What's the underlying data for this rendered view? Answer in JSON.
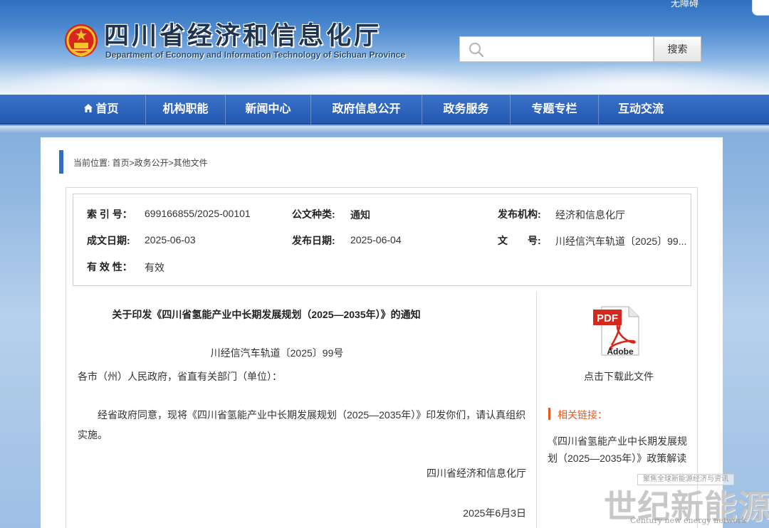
{
  "header": {
    "accessibility_label": "无障碍",
    "site_title": "四川省经济和信息化厅",
    "site_subtitle": "Department of Economy and Information Technology of Sichuan Province",
    "search": {
      "placeholder": "",
      "value": "",
      "button_label": "搜索"
    }
  },
  "nav": {
    "items": [
      {
        "label": "首页",
        "icon": "home-icon"
      },
      {
        "label": "机构职能"
      },
      {
        "label": "新闻中心"
      },
      {
        "label": "政府信息公开"
      },
      {
        "label": "政务服务"
      },
      {
        "label": "专题专栏"
      },
      {
        "label": "互动交流"
      }
    ]
  },
  "breadcrumb": "当前位置: 首页>政务公开>其他文件",
  "info": {
    "index_label": "索 引 号：",
    "index_value": "699166855/2025-00101",
    "category_label": "公文种类:",
    "category_value": "通知",
    "issuer_label": "发布机构:",
    "issuer_value": "经济和信息化厅",
    "created_label": "成文日期:",
    "created_value": "2025-06-03",
    "published_label": "发布日期:",
    "published_value": "2025-06-04",
    "docno_label": "文　　号:",
    "docno_value": "川经信汽车轨道〔2025〕99...",
    "validity_label": "有 效 性：",
    "validity_value": "有效"
  },
  "document": {
    "title": "关于印发《四川省氢能产业中长期发展规划（2025—2035年）》的通知",
    "number": "川经信汽车轨道〔2025〕99号",
    "addressee": "各市（州）人民政府，省直有关部门（单位）：",
    "body": "经省政府同意，现将《四川省氢能产业中长期发展规划（2025—2035年）》印发你们，请认真组织实施。",
    "signature": "四川省经济和信息化厅",
    "date": "2025年6月3日"
  },
  "sidebar": {
    "pdf_icon": "pdf-icon",
    "pdf_badge": "PDF",
    "pdf_brand": "Adobe",
    "download_label": "点击下载此文件",
    "related_heading": "相关链接：",
    "related_link": "《四川省氢能产业中长期发展规划（2025—2035年）》政策解读"
  },
  "watermark": {
    "tag": "聚焦全球新能源经济与资讯",
    "main": "世纪新能源网",
    "sub": "Century new energy network"
  },
  "colors": {
    "nav_blue": "#2558b0",
    "accent_orange": "#e8581c",
    "crumb_blue": "#2f6ec4",
    "pdf_red": "#d42a1e"
  }
}
